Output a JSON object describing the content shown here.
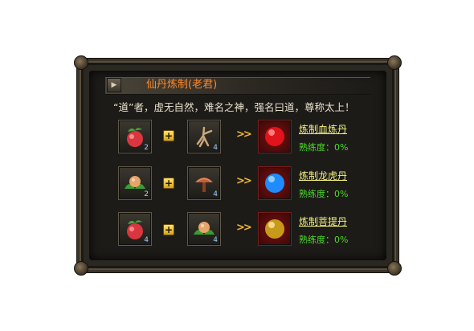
{
  "panel": {
    "title": "仙丹炼制(老君)",
    "quote": "“道”者，虚无自然，难名之神，强名曰道，尊称太上！"
  },
  "recipes": [
    {
      "ingredient1": {
        "icon": "peach-icon",
        "qty": "2"
      },
      "ingredient2": {
        "icon": "ginseng-root-icon",
        "qty": "4"
      },
      "result": {
        "icon": "red-orb-icon",
        "color": "#e0141a"
      },
      "action_label": "炼制血炼丹",
      "proficiency_label": "熟练度：0%"
    },
    {
      "ingredient1": {
        "icon": "lotus-fruit-icon",
        "qty": "2"
      },
      "ingredient2": {
        "icon": "lingzhi-mushroom-icon",
        "qty": "4"
      },
      "result": {
        "icon": "blue-orb-icon",
        "color": "#1e8cff"
      },
      "action_label": "炼制龙虎丹",
      "proficiency_label": "熟练度：0%"
    },
    {
      "ingredient1": {
        "icon": "peach-icon",
        "qty": "4"
      },
      "ingredient2": {
        "icon": "lotus-fruit-icon",
        "qty": "4"
      },
      "result": {
        "icon": "gold-orb-icon",
        "color": "#c89a1a"
      },
      "action_label": "炼制菩提丹",
      "proficiency_label": "熟练度：0%"
    }
  ]
}
